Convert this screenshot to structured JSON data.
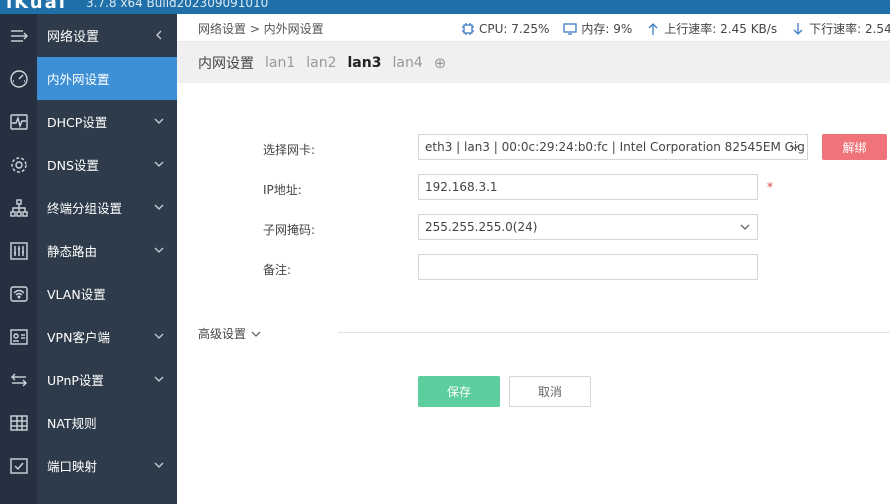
{
  "header": {
    "brand": "iKuai",
    "build": "3.7.8 x64 Build202309091010"
  },
  "nav": {
    "head_label": "网络设置",
    "items": [
      {
        "label": "内外网设置",
        "icon": "dashboard-icon",
        "active": true
      },
      {
        "label": "DHCP设置",
        "icon": "pulse-icon"
      },
      {
        "label": "DNS设置",
        "icon": "gear-icon"
      },
      {
        "label": "终端分组设置",
        "icon": "hierarchy-icon"
      },
      {
        "label": "静态路由",
        "icon": "sliders-icon"
      },
      {
        "label": "VLAN设置",
        "icon": "wifi-box-icon"
      },
      {
        "label": "VPN客户端",
        "icon": "id-card-icon"
      },
      {
        "label": "UPnP设置",
        "icon": "swap-arrows-icon"
      },
      {
        "label": "NAT规则",
        "icon": "grid-icon"
      },
      {
        "label": "端口映射",
        "icon": "checklist-icon"
      }
    ]
  },
  "breadcrumb": "网络设置 > 内外网设置",
  "status": {
    "cpu": "CPU: 7.25%",
    "mem": "内存: 9%",
    "up": "上行速率: 2.45 KB/s",
    "down": "下行速率: 2.54"
  },
  "tabs": [
    "内网设置",
    "lan1",
    "lan2",
    "lan3",
    "lan4"
  ],
  "form": {
    "nic_label": "选择网卡:",
    "nic_value": "eth3 | lan3 | 00:0c:29:24:b0:fc | Intel Corporation 82545EM Gig",
    "unbind_label": "解绑",
    "ip_label": "IP地址:",
    "ip_value": "192.168.3.1",
    "required_mark": "*",
    "mask_label": "子网掩码:",
    "mask_value": "255.255.255.0(24)",
    "note_label": "备注:",
    "note_value": ""
  },
  "advanced_label": "高级设置",
  "buttons": {
    "save": "保存",
    "cancel": "取消"
  },
  "colors": {
    "accent": "#3d8fd6",
    "save": "#5ccd9c",
    "danger": "#f0737a",
    "sidebar": "#2e3b4a"
  }
}
